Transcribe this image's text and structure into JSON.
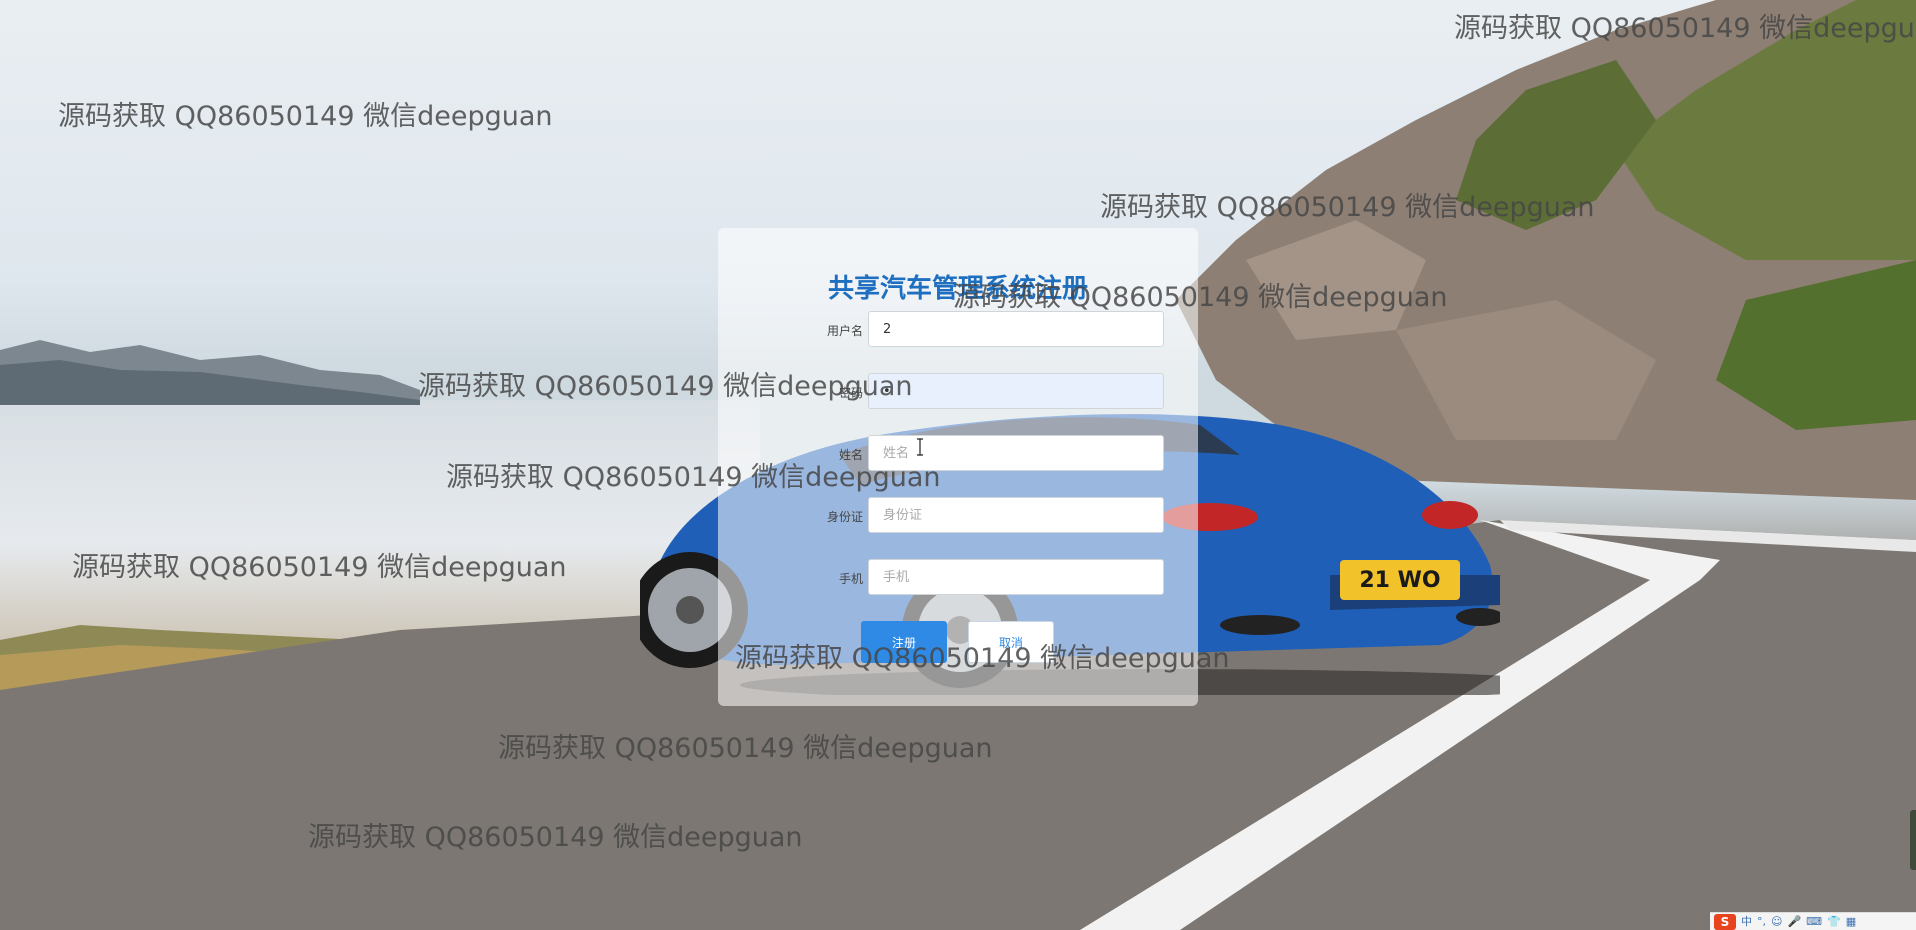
{
  "form": {
    "title": "共享汽车管理系统注册",
    "fields": [
      {
        "label": "用户名",
        "value": "2",
        "placeholder": ""
      },
      {
        "label": "密码",
        "value": "•",
        "placeholder": ""
      },
      {
        "label": "姓名",
        "value": "",
        "placeholder": "姓名"
      },
      {
        "label": "身份证",
        "value": "",
        "placeholder": "身份证"
      },
      {
        "label": "手机",
        "value": "",
        "placeholder": "手机"
      }
    ],
    "register_label": "注册",
    "cancel_label": "取消"
  },
  "watermark_text": "源码获取 QQ86050149 微信deepguan",
  "tray": {
    "ime_logo": "S",
    "lang": "中",
    "items": [
      "°,",
      "☺",
      "🎤",
      "⌨",
      "👕",
      "▦"
    ]
  },
  "colors": {
    "title": "#1e6fbf",
    "register_button": "#2f8ae6",
    "car_body": "#1f5fb8"
  },
  "license_plate": "21 WO"
}
